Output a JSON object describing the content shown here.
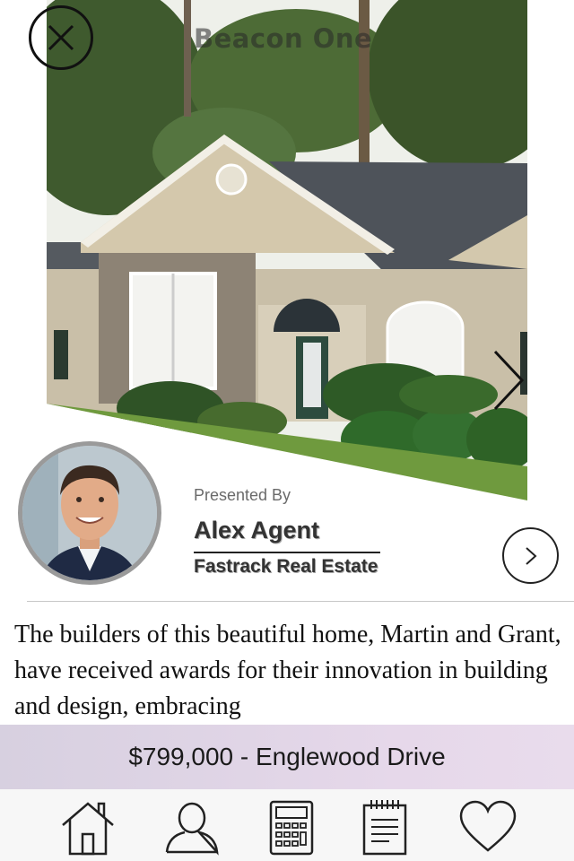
{
  "hero": {
    "title": "Beacon One",
    "close_icon": "close-x-icon",
    "next_icon": "chevron-right-icon"
  },
  "presenter": {
    "presented_by_label": "Presented By",
    "agent_name": "Alex Agent",
    "agency_name": "Fastrack Real Estate",
    "arrow_icon": "circle-chevron-right-icon"
  },
  "description": {
    "text": "The builders of this beautiful home, Martin and Grant, have received awards for their innovation in building and design, embracing"
  },
  "listing": {
    "price_address": "$799,000 - Englewood Drive"
  },
  "tabs": [
    {
      "icon": "home-icon"
    },
    {
      "icon": "person-icon"
    },
    {
      "icon": "calculator-icon"
    },
    {
      "icon": "notepad-icon"
    },
    {
      "icon": "heart-icon"
    }
  ],
  "colors": {
    "price_bar": "#e2d6e8",
    "tab_bar": "#f7f7f7",
    "text": "#111111"
  }
}
